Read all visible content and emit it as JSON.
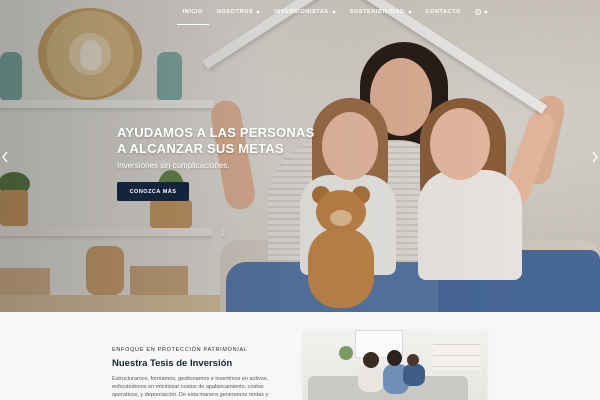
{
  "nav": {
    "items": [
      {
        "label": "INICIO",
        "active": true,
        "dropdown": false
      },
      {
        "label": "NOSOTROS",
        "active": false,
        "dropdown": true
      },
      {
        "label": "INVERSIONISTAS",
        "active": false,
        "dropdown": true
      },
      {
        "label": "SOSTENIBILIDAD",
        "active": false,
        "dropdown": true
      },
      {
        "label": "CONTACTO",
        "active": false,
        "dropdown": false
      }
    ],
    "language_icon": "globe-icon"
  },
  "hero": {
    "title_line1": "AYUDAMOS A LAS PERSONAS",
    "title_line2": "A ALCANZAR SUS METAS",
    "subtitle": "Inversiones sin complicaciones.",
    "cta_label": "CONOZCA MÁS",
    "prev_icon": "chevron-left-icon",
    "next_icon": "chevron-right-icon"
  },
  "section": {
    "eyebrow": "ENFOQUE EN PROTECCIÓN PATRIMONIAL",
    "title": "Nuestra Tesis de Inversión",
    "body": "Estructuramos, formamos, gestionamos e invertimos en activos, enfocándonos en minimizar costos de apalancamiento, costos operativos, y depreciación. De esta manera generamos rentas y"
  },
  "colors": {
    "cta_bg": "#15243d",
    "lower_bg": "#f7f7f8",
    "heading": "#1a2234"
  }
}
